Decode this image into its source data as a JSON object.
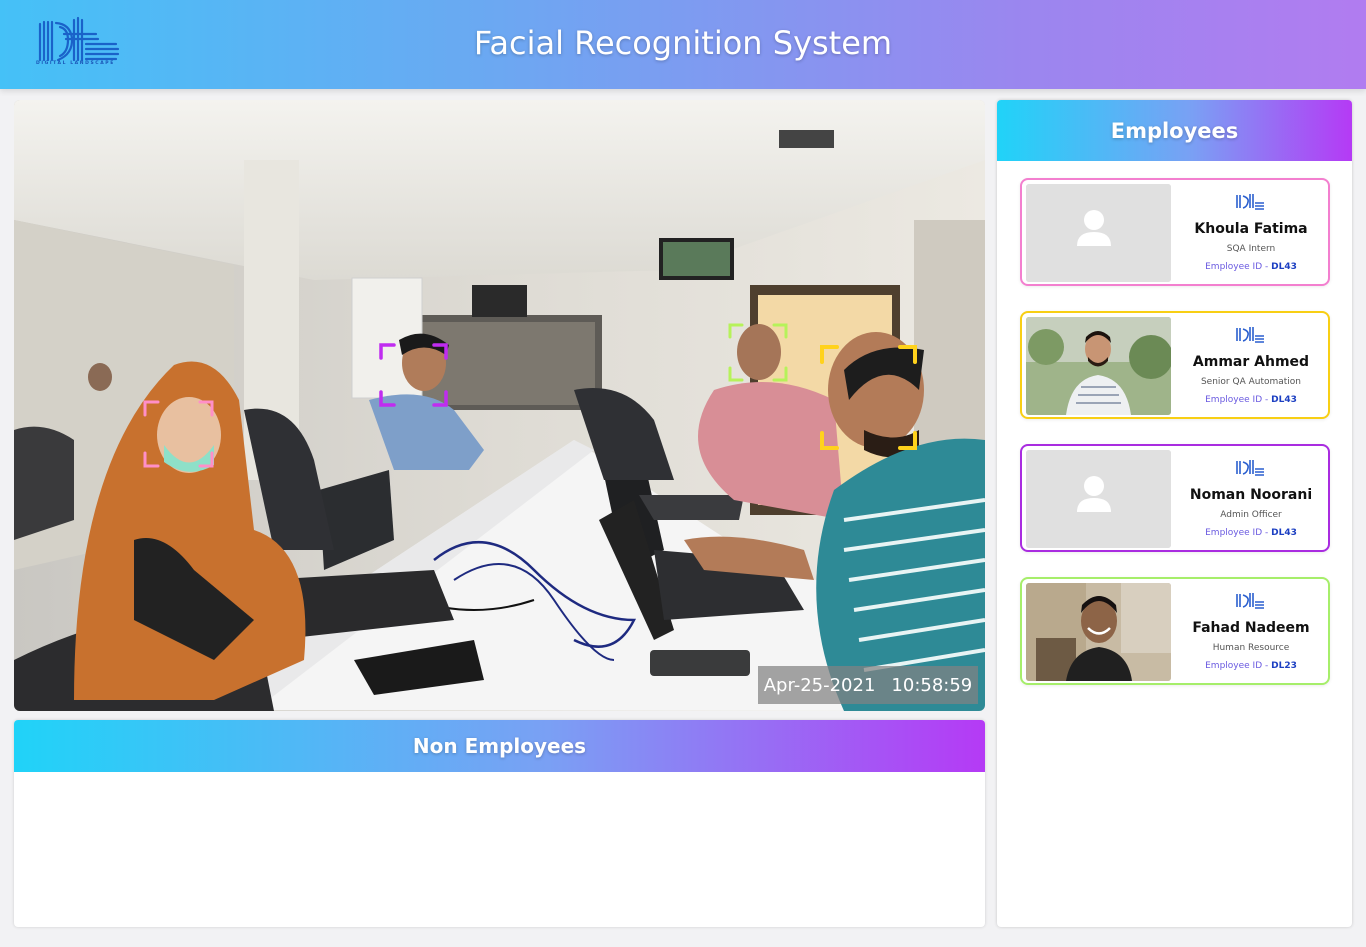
{
  "header": {
    "title": "Facial Recognition System",
    "logo_text": "DIGITAL LANDSCAPE"
  },
  "camera": {
    "date": "Apr-25-2021",
    "time": "10:58:59",
    "face_box_colors": [
      "#ff8fc8",
      "#c02cf0",
      "#b6f25a",
      "#ffd21c"
    ]
  },
  "non_employees": {
    "title": "Non Employees"
  },
  "employees_panel": {
    "title": "Employees",
    "id_prefix": "Employee ID -",
    "items": [
      {
        "name": "Khoula Fatima",
        "role": "SQA Intern",
        "id": "DL43",
        "border_color": "#f37fcf",
        "photo": "placeholder-avatar"
      },
      {
        "name": "Ammar Ahmed",
        "role": "Senior QA Automation",
        "id": "DL43",
        "border_color": "#f8cf14",
        "photo": "person-photo"
      },
      {
        "name": "Noman Noorani",
        "role": "Admin Officer",
        "id": "DL43",
        "border_color": "#a92ce0",
        "photo": "placeholder-avatar"
      },
      {
        "name": "Fahad Nadeem",
        "role": "Human Resource",
        "id": "DL23",
        "border_color": "#a6ee6a",
        "photo": "person-photo"
      }
    ]
  }
}
